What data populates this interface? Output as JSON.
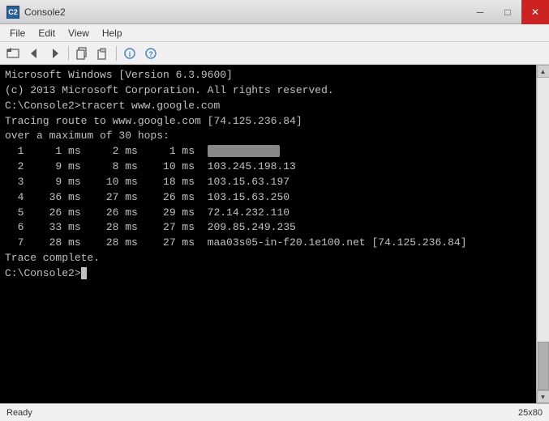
{
  "window": {
    "title": "Console2",
    "icon_label": "C2"
  },
  "titlebar": {
    "minimize_label": "─",
    "maximize_label": "□",
    "close_label": "✕"
  },
  "menu": {
    "items": [
      "File",
      "Edit",
      "View",
      "Help"
    ]
  },
  "toolbar": {
    "buttons": [
      {
        "icon": "📁",
        "name": "new-tab"
      },
      {
        "icon": "←",
        "name": "back"
      },
      {
        "icon": "→",
        "name": "forward"
      },
      {
        "sep": true
      },
      {
        "icon": "📋",
        "name": "copy"
      },
      {
        "icon": "📄",
        "name": "paste"
      },
      {
        "sep": true
      },
      {
        "icon": "ℹ",
        "name": "info"
      },
      {
        "icon": "?",
        "name": "help"
      }
    ]
  },
  "terminal": {
    "lines": [
      "Microsoft Windows [Version 6.3.9600]",
      "(c) 2013 Microsoft Corporation. All rights reserved.",
      "",
      "C:\\Console2>tracert www.google.com",
      "",
      "Tracing route to www.google.com [74.125.236.84]",
      "over a maximum of 30 hops:",
      "",
      "  1     1 ms     2 ms     1 ms  BLURRED_IP",
      "  2     9 ms     8 ms    10 ms  103.245.198.13",
      "  3     9 ms    10 ms    18 ms  103.15.63.197",
      "  4    36 ms    27 ms    26 ms  103.15.63.250",
      "  5    26 ms    26 ms    29 ms  72.14.232.110",
      "  6    33 ms    28 ms    27 ms  209.85.249.235",
      "  7    28 ms    28 ms    27 ms  maa03s05-in-f20.1e100.net [74.125.236.84]",
      "",
      "Trace complete.",
      "",
      "C:\\Console2>"
    ]
  },
  "statusbar": {
    "status_text": "Ready",
    "dimensions": "25x80"
  }
}
